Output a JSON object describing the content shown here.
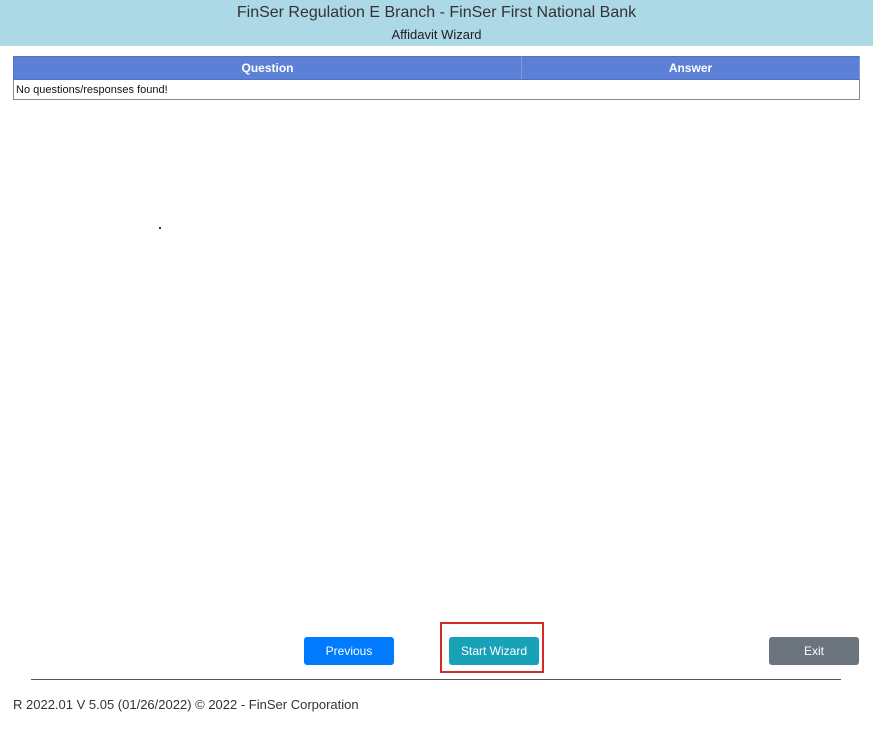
{
  "header": {
    "title": "FinSer Regulation E Branch - FinSer First National Bank",
    "subtitle": "Affidavit Wizard"
  },
  "table": {
    "columns": [
      "Question",
      "Answer"
    ],
    "empty_message": "No questions/responses found!"
  },
  "buttons": {
    "previous": "Previous",
    "start_wizard": "Start Wizard",
    "exit": "Exit"
  },
  "footer": {
    "text": "R 2022.01 V 5.05 (01/26/2022) © 2022 - FinSer Corporation"
  },
  "colors": {
    "header_bg": "#add8e6",
    "table_header_bg": "#5b80d6",
    "previous_btn": "#007bff",
    "start_btn": "#17a2b8",
    "exit_btn": "#6c757d",
    "highlight": "#d42a2a"
  }
}
